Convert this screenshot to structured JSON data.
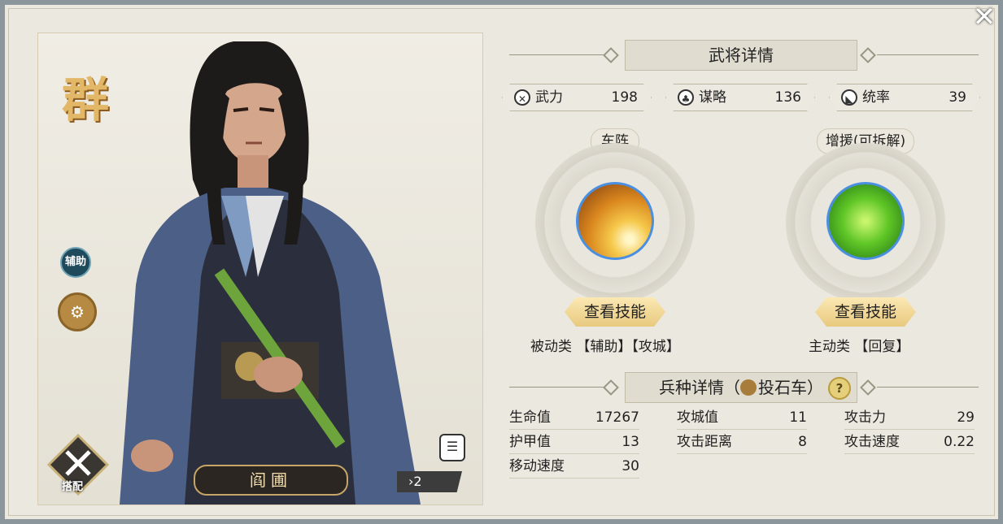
{
  "faction": "群",
  "hero": {
    "name": "阎圃",
    "stars": "2"
  },
  "role_tags": {
    "aux": "辅助"
  },
  "equip_label": "搭配",
  "detail_title": "武将详情",
  "stats": [
    {
      "icon": "sword-icon",
      "label": "武力",
      "value": "198"
    },
    {
      "icon": "strategy-icon",
      "label": "谋略",
      "value": "136"
    },
    {
      "icon": "command-flag-icon",
      "label": "统率",
      "value": "39"
    }
  ],
  "skills": [
    {
      "name": "车阵",
      "button": "查看技能",
      "type": "被动类",
      "tags": "【辅助】【攻城】"
    },
    {
      "name": "增援(可拆解)",
      "button": "查看技能",
      "type": "主动类",
      "tags": "【回复】"
    }
  ],
  "troop": {
    "title_prefix": "兵种详情（",
    "unit": "投石车",
    "title_suffix": "）"
  },
  "troop_stats": [
    [
      {
        "k": "生命值",
        "v": "17267"
      },
      {
        "k": "攻城值",
        "v": "11"
      },
      {
        "k": "攻击力",
        "v": "29"
      }
    ],
    [
      {
        "k": "护甲值",
        "v": "13"
      },
      {
        "k": "攻击距离",
        "v": "8"
      },
      {
        "k": "攻击速度",
        "v": "0.22"
      }
    ],
    [
      {
        "k": "移动速度",
        "v": "30"
      }
    ]
  ]
}
